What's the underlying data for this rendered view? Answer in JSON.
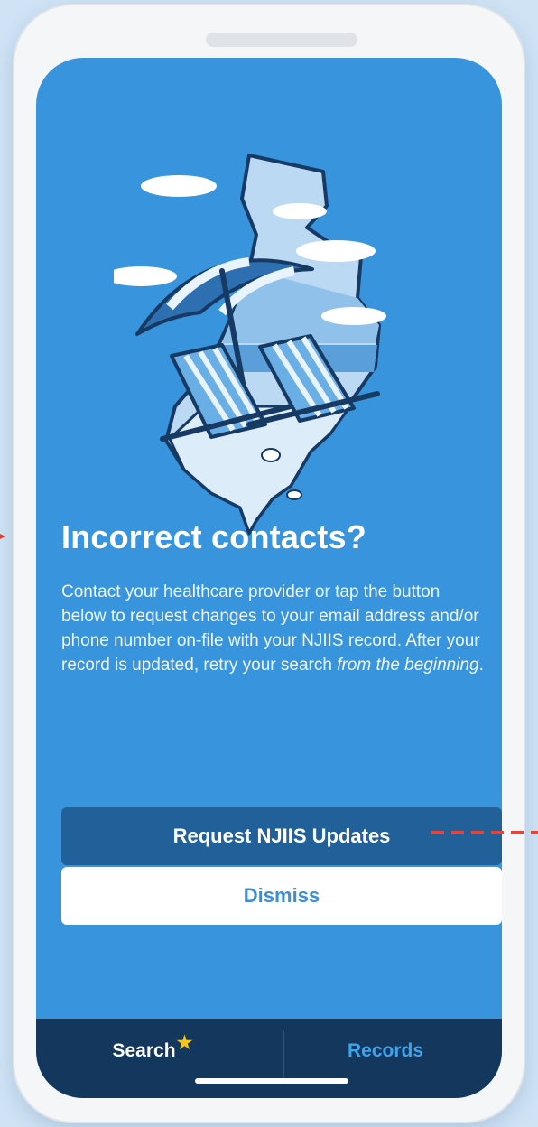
{
  "screen": {
    "title": "Incorrect contacts?",
    "body_main": "Contact your healthcare provider or tap the button below to request changes to your email address and/or phone number on-file with your NJIIS record. After your record is updated, retry your search ",
    "body_emphasis": "from the beginning",
    "body_end": "."
  },
  "buttons": {
    "primary_label": "Request NJIIS Updates",
    "secondary_label": "Dismiss"
  },
  "tabbar": {
    "search_label": "Search",
    "records_label": "Records",
    "search_badge": "★"
  },
  "colors": {
    "screen_bg": "#3894dc",
    "primary_button": "#22609a",
    "tabbar_bg": "#14375e",
    "records_tab": "#3fa3ec",
    "star": "#f5c518",
    "annotation_arrow": "#e0463a"
  },
  "icons": {
    "illustration": "beach-chairs-new-jersey-illustration",
    "badge": "star-icon"
  }
}
